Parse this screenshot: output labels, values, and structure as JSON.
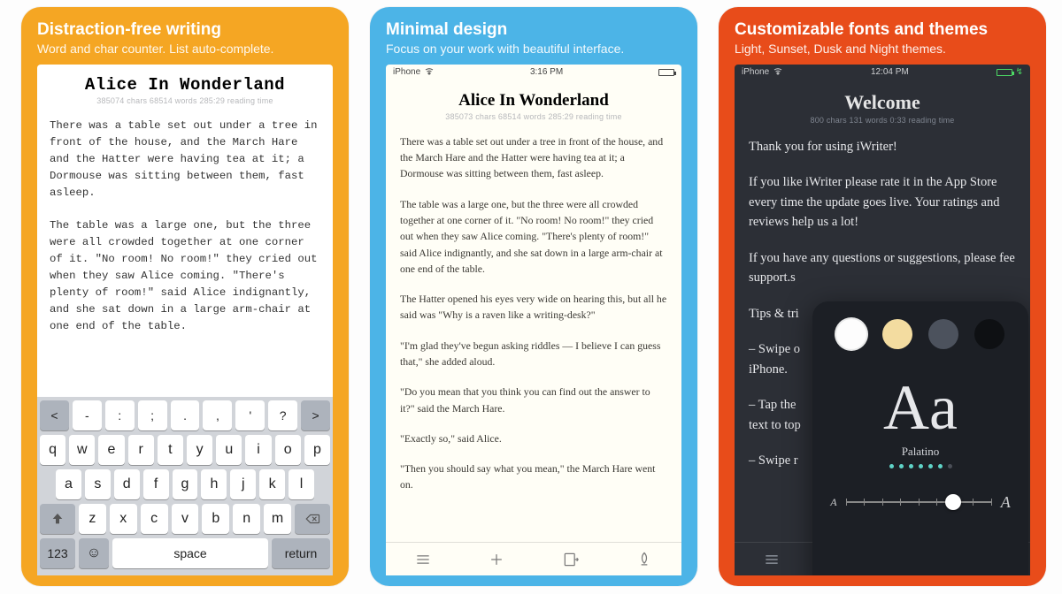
{
  "panels": [
    {
      "headline": "Distraction-free writing",
      "subline": "Word and char counter. List auto-complete.",
      "doc_title": "Alice In Wonderland",
      "doc_stats": "385074 chars   68514 words   285:29 reading time",
      "p1": "There was a table set out under a tree in front of the house, and the March Hare and the Hatter were having tea at it; a Dormouse was sitting between them, fast asleep.",
      "p2": "The table was a large one, but the three were all crowded together at one corner of it. \"No room! No room!\" they cried out when they saw Alice coming. \"There's plenty of room!\" said Alice indignantly, and she sat down in a large arm-chair at one end of the table.",
      "kbd_punct": [
        "<",
        "-",
        ":",
        ";",
        ".",
        ",",
        "'",
        "?",
        ">"
      ],
      "kbd_r1": [
        "q",
        "w",
        "e",
        "r",
        "t",
        "y",
        "u",
        "i",
        "o",
        "p"
      ],
      "kbd_r2": [
        "a",
        "s",
        "d",
        "f",
        "g",
        "h",
        "j",
        "k",
        "l"
      ],
      "kbd_r3": [
        "z",
        "x",
        "c",
        "v",
        "b",
        "n",
        "m"
      ],
      "kbd_bottom": {
        "num": "123",
        "space": "space",
        "ret": "return"
      }
    },
    {
      "headline": "Minimal design",
      "subline": "Focus on your work with beautiful interface.",
      "status_time": "3:16 PM",
      "status_carrier": "iPhone",
      "doc_title": "Alice In Wonderland",
      "doc_stats": "385073 chars   68514 words   285:29 reading time",
      "p1": "There was a table set out under a tree in front of the house, and the March Hare and the Hatter were having tea at it; a Dormouse was sitting between them, fast asleep.",
      "p2": "The table was a large one, but the three were all crowded together at one corner of it. \"No room! No room!\" they cried out when they saw Alice coming. \"There's plenty of room!\" said Alice indignantly, and she sat down in a large arm-chair at one end of the table.",
      "p3": "The Hatter opened his eyes very wide on hearing this, but all he said was \"Why is a raven like a writing-desk?\"",
      "p4": "\"I'm glad they've begun asking riddles — I believe I can guess that,\" she added aloud.",
      "p5": "\"Do you mean that you think you can find out the answer to it?\" said the March Hare.",
      "p6": "\"Exactly so,\" said Alice.",
      "p7": "\"Then you should say what you mean,\" the March Hare went on."
    },
    {
      "headline": "Customizable fonts and themes",
      "subline": "Light, Sunset, Dusk and Night themes.",
      "status_time": "12:04 PM",
      "status_carrier": "iPhone",
      "doc_title": "Welcome",
      "doc_stats": "800 chars   131 words   0:33 reading time",
      "p1": "Thank you for using iWriter!",
      "p2": "If you like iWriter please rate it in the App Store every time the update goes live. Your ratings and reviews help us a lot!",
      "p3": "If you have any questions or suggestions, please fee",
      "p3b": "support.s",
      "p4": "Tips & tri",
      "p5": "– Swipe o",
      "p5b": "iPhone.",
      "p6": "– Tap the",
      "p6b": "text to top",
      "p7": "– Swipe r",
      "font_sample": "Aa",
      "font_name": "Palatino"
    }
  ]
}
